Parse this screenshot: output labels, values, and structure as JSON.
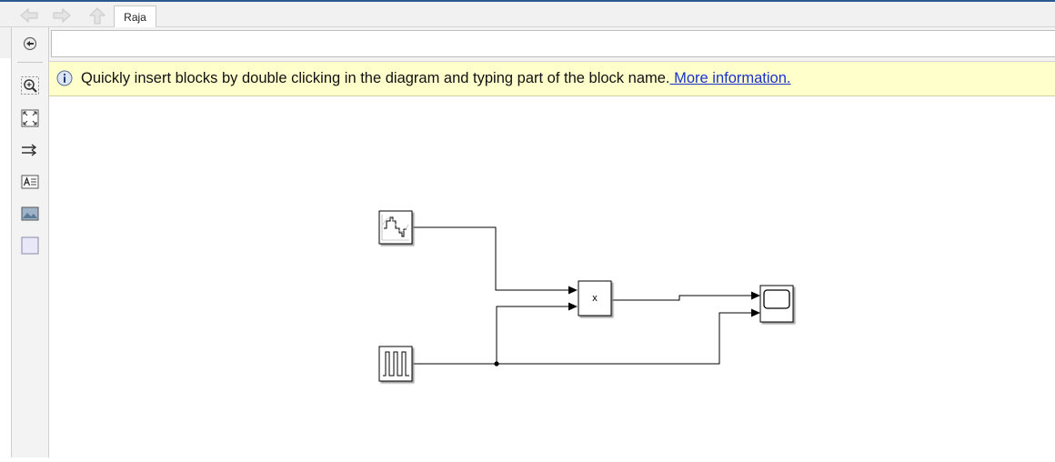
{
  "window": {
    "tab_label": "Raja"
  },
  "toolbar": {
    "back_icon": "back-arrow-icon",
    "forward_icon": "forward-arrow-icon",
    "up_icon": "up-arrow-icon"
  },
  "palette": {
    "items": [
      {
        "name": "hide-browser-icon"
      },
      {
        "name": "zoom-icon"
      },
      {
        "name": "fit-to-view-icon"
      },
      {
        "name": "signal-arrows-icon"
      },
      {
        "name": "annotation-icon"
      },
      {
        "name": "image-icon"
      },
      {
        "name": "area-icon"
      }
    ]
  },
  "address": {
    "value": ""
  },
  "infobar": {
    "message": "Quickly insert blocks by double clicking in the diagram and typing part of the block name.",
    "link": " More information."
  },
  "diagram": {
    "product_label": "x"
  }
}
